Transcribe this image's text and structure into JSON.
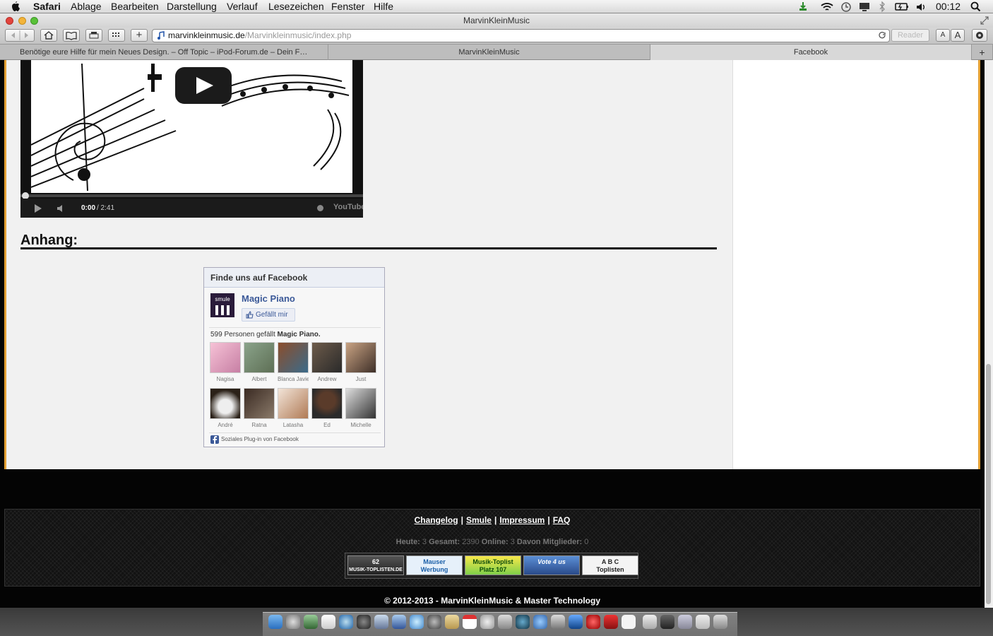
{
  "menubar": {
    "app": "Safari",
    "items": [
      "Ablage",
      "Bearbeiten",
      "Darstellung",
      "Verlauf",
      "Lesezeichen",
      "Fenster",
      "Hilfe"
    ],
    "clock": "00:12"
  },
  "window": {
    "title": "MarvinKleinMusic"
  },
  "toolbar": {
    "url_host": "marvinkleinmusic.de",
    "url_path": "/Marvinkleinmusic/index.php",
    "reader_label": "Reader",
    "font_small": "A",
    "font_large": "A",
    "add_label": "+"
  },
  "tabs": [
    {
      "label": "Benötige eure Hilfe für mein Neues Design. – Off Topic – iPod-Forum.de – Dein F…"
    },
    {
      "label": "MarvinKleinMusic"
    },
    {
      "label": "Facebook"
    }
  ],
  "video": {
    "time_current": "0:00",
    "time_total": "/ 2:41",
    "brand": "YouTube"
  },
  "anhang": {
    "heading": "Anhang:"
  },
  "facebook": {
    "header": "Finde uns auf Facebook",
    "page_name": "Magic Piano",
    "logo_text": "smule",
    "like_button": "Gefällt mir",
    "count_text": "599 Personen gefällt",
    "count_page": "Magic Piano.",
    "fans": [
      {
        "name": "Nagisa"
      },
      {
        "name": "Albert"
      },
      {
        "name": "Blanca Javie"
      },
      {
        "name": "Andrew"
      },
      {
        "name": "Just"
      },
      {
        "name": "André"
      },
      {
        "name": "Ratna"
      },
      {
        "name": "Latasha"
      },
      {
        "name": "Ed"
      },
      {
        "name": "Michelle"
      }
    ],
    "plugin_text": "Soziales Plug-in von Facebook"
  },
  "footer": {
    "links": [
      "Changelog",
      "Smule",
      "Impressum",
      "FAQ"
    ],
    "separator": "|",
    "stats": {
      "heute_label": "Heute:",
      "heute": "3",
      "gesamt_label": "Gesamt:",
      "gesamt": "2390",
      "online_label": "Online:",
      "online": "3",
      "mitglieder_label": "Davon Mitglieder:",
      "mitglieder": "0"
    },
    "badges": [
      {
        "top": "62",
        "bottom": "MUSIK-TOPLISTEN.DE"
      },
      {
        "top": "Mauser",
        "bottom": "Werbung"
      },
      {
        "top": "Musik-Toplist",
        "bottom": "Platz 107"
      },
      {
        "top": "Vote 4 us",
        "bottom": ""
      },
      {
        "top": "A B C",
        "bottom": "Toplisten"
      }
    ],
    "copyright": "© 2012-2013 - MarvinKleinMusic & Master Technology"
  }
}
